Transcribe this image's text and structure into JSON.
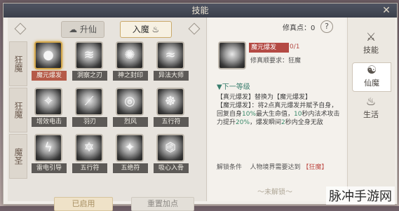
{
  "window": {
    "title": "技能",
    "close_glyph": "✕"
  },
  "tabs": [
    {
      "label": "升仙",
      "icon": "cloud-icon"
    },
    {
      "label": "入魔",
      "icon": "flame-icon"
    }
  ],
  "rows": [
    {
      "label": "狂魔",
      "skills": [
        {
          "name": "魔元爆发",
          "glyph": "●"
        },
        {
          "name": "洞察之刃",
          "glyph": "≋"
        },
        {
          "name": "神之封印",
          "glyph": "✺"
        },
        {
          "name": "异法大师",
          "glyph": "≈"
        }
      ]
    },
    {
      "label": "狂魔",
      "skills": [
        {
          "name": "增效电击",
          "glyph": "✧"
        },
        {
          "name": "羽刃",
          "glyph": "⟋"
        },
        {
          "name": "烈风",
          "glyph": "◎"
        },
        {
          "name": "五行符",
          "glyph": "☸"
        }
      ]
    },
    {
      "label": "魔圣",
      "skills": [
        {
          "name": "雷电引导",
          "glyph": "ϟ"
        },
        {
          "name": "五行符",
          "glyph": "✡"
        },
        {
          "name": "五绝符",
          "glyph": "✦"
        },
        {
          "name": "吸心入骨",
          "glyph": "⌬"
        }
      ]
    }
  ],
  "buttons": {
    "enabled": "已启用",
    "reset": "重置加点"
  },
  "detail": {
    "points_label": "修真点：0",
    "help_glyph": "?",
    "name": "魔元爆发",
    "level": "0/1",
    "requirement": "修真顺要求：狂魔",
    "next_level_label": "▼下一等级",
    "desc_line1": "【真元爆发】替换为【魔元爆发】",
    "desc_line2_a": "【魔元爆发】：将2点真元爆发并赋予自身，",
    "desc_line3_a": "回复自身",
    "desc_line3_b": "10%",
    "desc_line3_c": "最大生命值，",
    "desc_line3_d": "10",
    "desc_line3_e": "秒内法术攻击",
    "desc_line4_a": "力提升",
    "desc_line4_b": "20%",
    "desc_line4_c": "，爆发瞬间",
    "desc_line4_d": "2",
    "desc_line4_e": "秒内全身无敌",
    "unlock_label": "解锁条件",
    "unlock_text": "人物境界需要达到",
    "unlock_value": "【狂魔】",
    "status": "～未解锁～"
  },
  "side_tabs": [
    {
      "label": "技能",
      "glyph": "⚔"
    },
    {
      "label": "仙魔",
      "glyph": "☯"
    },
    {
      "label": "生活",
      "glyph": "♨"
    }
  ],
  "watermark": "脉冲手游网"
}
